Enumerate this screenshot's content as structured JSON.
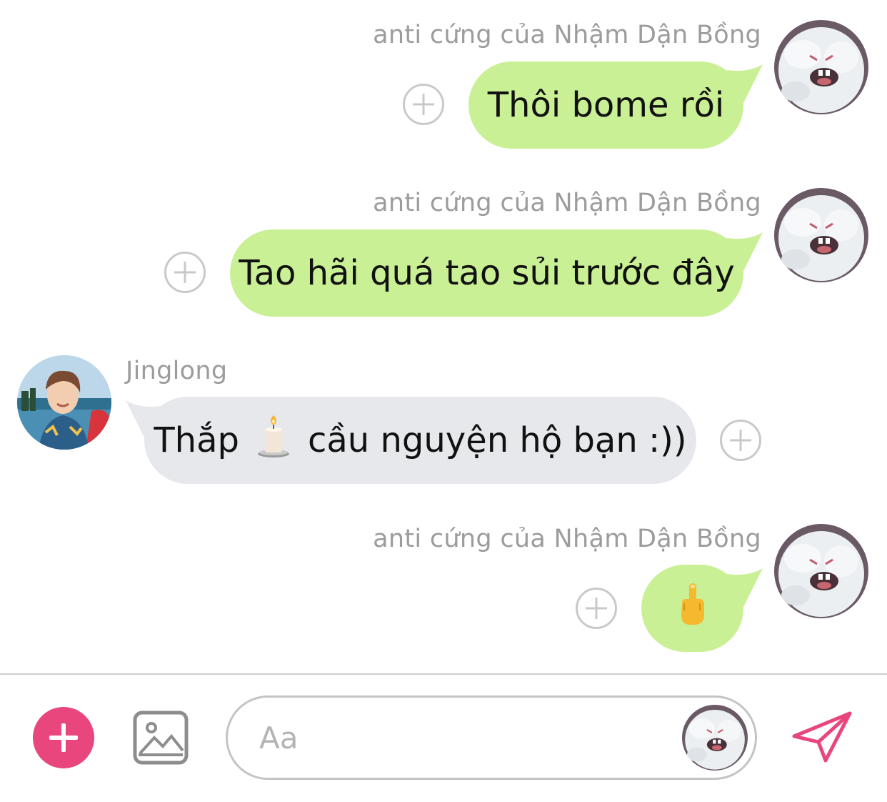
{
  "messages": [
    {
      "sender": "anti cứng của Nhậm Dận Bồng",
      "text": "Thôi bome rồi"
    },
    {
      "sender": "anti cứng của Nhậm Dận Bồng",
      "text": "Tao hãi quá tao sủi trước đây"
    },
    {
      "sender": "Jinglong",
      "text_before": "Thắp",
      "text_after": "cầu nguyện hộ bạn :))",
      "emoji": "candle-icon"
    },
    {
      "sender": "anti cứng của Nhậm Dận Bồng",
      "emoji": "middle-finger-icon"
    }
  ],
  "composer": {
    "placeholder": "Aa",
    "icons": [
      "plus-icon",
      "image-icon",
      "avatar",
      "send-icon"
    ]
  },
  "colors": {
    "my_bubble": "#c9f095",
    "their_bubble": "#e6e8ec",
    "accent": "#e8467c",
    "sender_text": "#9c9c9c"
  }
}
